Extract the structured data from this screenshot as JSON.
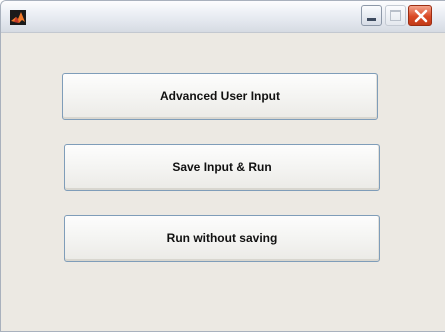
{
  "window": {
    "title": "",
    "icon": "matlab-icon"
  },
  "title_controls": {
    "minimize": "minimize-icon",
    "maximize": "maximize-icon",
    "close": "close-icon"
  },
  "buttons": [
    {
      "label": "Advanced User Input"
    },
    {
      "label": "Save Input & Run"
    },
    {
      "label": "Run without saving"
    }
  ],
  "colors": {
    "window_background": "#ece9e3",
    "button_border": "#7f9db9",
    "close_button": "#d94a26"
  }
}
